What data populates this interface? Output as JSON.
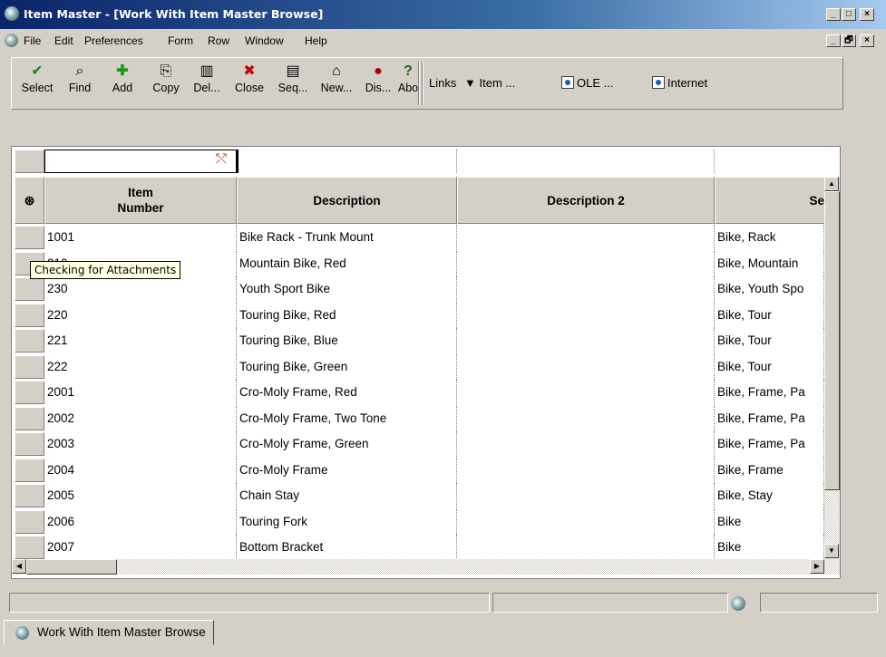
{
  "window": {
    "title": "Item Master - [Work With Item Master Browse]",
    "controls": [
      "_",
      "□",
      "×"
    ],
    "inner_controls": [
      "_",
      "🗗",
      "×"
    ]
  },
  "menu": [
    "File",
    "Edit",
    "Preferences",
    "Form",
    "Row",
    "Window",
    "Help"
  ],
  "toolbar": {
    "buttons": [
      {
        "label": "Select",
        "icon": "checkmark-icon",
        "glyph": "✔",
        "color": "#1a8a1a"
      },
      {
        "label": "Find",
        "icon": "find-icon",
        "glyph": "🔍",
        "color": "#000000"
      },
      {
        "label": "Add",
        "icon": "add-icon",
        "glyph": "✚",
        "color": "#1a9a1a"
      },
      {
        "label": "Copy",
        "icon": "copy-icon",
        "glyph": "⎘",
        "color": "#000000"
      },
      {
        "label": "Del...",
        "icon": "trash-icon",
        "glyph": "🗑",
        "color": "#000000"
      },
      {
        "label": "Close",
        "icon": "close-icon",
        "glyph": "✖",
        "color": "#cc0000"
      },
      {
        "label": "Seq...",
        "icon": "sequence-icon",
        "glyph": "📄",
        "color": "#000000"
      },
      {
        "label": "New...",
        "icon": "new-layout-icon",
        "glyph": "🗂",
        "color": "#000000"
      },
      {
        "label": "Dis...",
        "icon": "display-icon",
        "glyph": "👓",
        "color": "#aa0000"
      },
      {
        "label": "Abo",
        "icon": "about-icon",
        "glyph": "?",
        "color": "#1a6a1a"
      }
    ],
    "links_label": "Links",
    "item_link": "Item ...",
    "ole_link": "OLE ...",
    "internet_link": "Internet"
  },
  "grid": {
    "columns": [
      {
        "label": "Item Number",
        "label_line1": "Item",
        "label_line2": "Number"
      },
      {
        "label": "Description"
      },
      {
        "label": "Description 2"
      },
      {
        "label": "Se"
      }
    ],
    "rows": [
      {
        "item": "1001",
        "desc": "Bike Rack - Trunk Mount",
        "desc2": "",
        "search": "Bike, Rack"
      },
      {
        "item": "210",
        "desc": "Mountain Bike, Red",
        "desc2": "",
        "search": "Bike, Mountain"
      },
      {
        "item": "230",
        "desc": "Youth Sport Bike",
        "desc2": "",
        "search": "Bike, Youth Spo"
      },
      {
        "item": "220",
        "desc": "Touring Bike, Red",
        "desc2": "",
        "search": "Bike, Tour"
      },
      {
        "item": "221",
        "desc": "Touring Bike, Blue",
        "desc2": "",
        "search": "Bike, Tour"
      },
      {
        "item": "222",
        "desc": "Touring Bike, Green",
        "desc2": "",
        "search": "Bike, Tour"
      },
      {
        "item": "2001",
        "desc": "Cro-Moly Frame, Red",
        "desc2": "",
        "search": "Bike, Frame, Pa"
      },
      {
        "item": "2002",
        "desc": "Cro-Moly Frame, Two Tone",
        "desc2": "",
        "search": "Bike, Frame, Pa"
      },
      {
        "item": "2003",
        "desc": "Cro-Moly Frame, Green",
        "desc2": "",
        "search": "Bike, Frame, Pa"
      },
      {
        "item": "2004",
        "desc": "Cro-Moly Frame",
        "desc2": "",
        "search": "Bike, Frame"
      },
      {
        "item": "2005",
        "desc": "Chain Stay",
        "desc2": "",
        "search": "Bike, Stay"
      },
      {
        "item": "2006",
        "desc": "Touring Fork",
        "desc2": "",
        "search": "Bike"
      },
      {
        "item": "2007",
        "desc": "Bottom Bracket",
        "desc2": "",
        "search": "Bike"
      }
    ]
  },
  "tooltip": "Checking for Attachments",
  "tab": {
    "label": "Work With Item Master Browse"
  }
}
